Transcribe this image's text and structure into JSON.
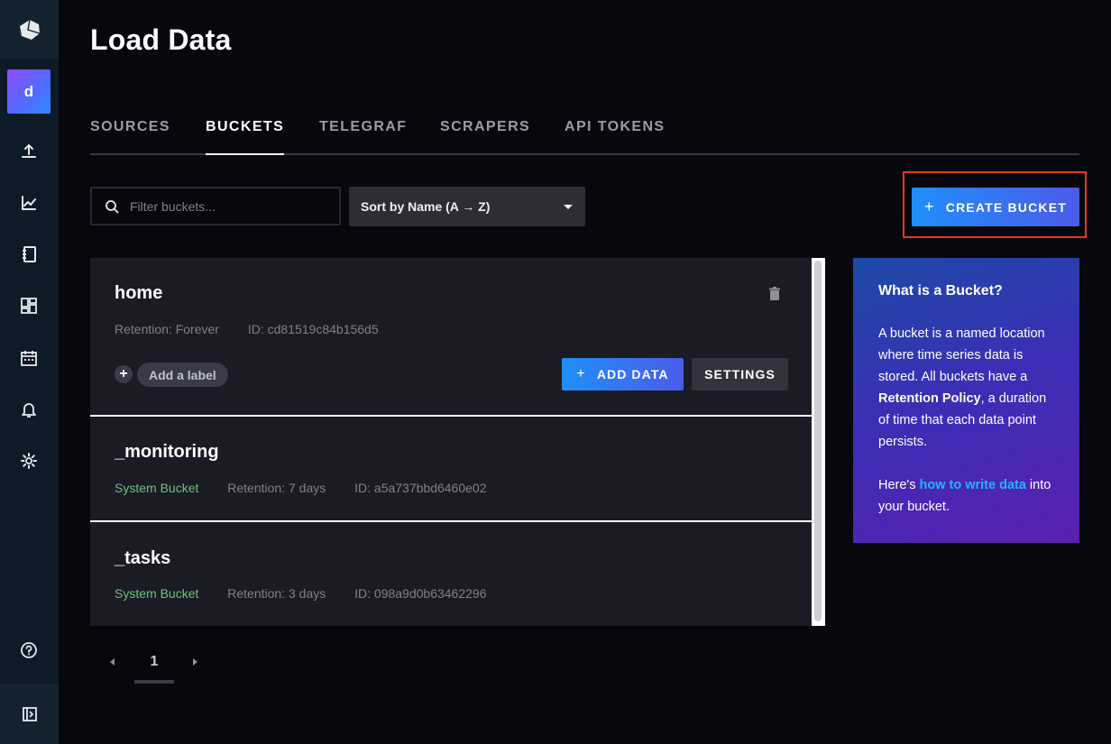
{
  "sidebar": {
    "avatar_letter": "d",
    "icons": [
      "influx-logo-icon",
      "upload-icon",
      "graph-icon",
      "notebook-icon",
      "dashboard-icon",
      "calendar-icon",
      "bell-icon",
      "gear-icon",
      "help-icon",
      "collapse-icon"
    ]
  },
  "header": {
    "title": "Load Data"
  },
  "tabs": [
    {
      "label": "SOURCES",
      "active": false
    },
    {
      "label": "BUCKETS",
      "active": true
    },
    {
      "label": "TELEGRAF",
      "active": false
    },
    {
      "label": "SCRAPERS",
      "active": false
    },
    {
      "label": "API TOKENS",
      "active": false
    }
  ],
  "filter": {
    "placeholder": "Filter buckets...",
    "value": ""
  },
  "sort": {
    "label": "Sort by Name (A → Z)"
  },
  "create_button": {
    "plus": "+",
    "label": "CREATE BUCKET"
  },
  "buckets": [
    {
      "name": "home",
      "retention": "Retention: Forever",
      "id": "ID: cd81519c84b156d5",
      "add_label": "Add a label",
      "add_label_plus": "+",
      "add_data": "ADD DATA",
      "add_data_plus": "+",
      "settings": "SETTINGS"
    },
    {
      "name": "_monitoring",
      "system": "System Bucket",
      "retention": "Retention: 7 days",
      "id": "ID: a5a737bbd6460e02"
    },
    {
      "name": "_tasks",
      "system": "System Bucket",
      "retention": "Retention: 3 days",
      "id": "ID: 098a9d0b63462296"
    }
  ],
  "info": {
    "title": "What is a Bucket?",
    "p1_start": "A bucket is a named location where time series data is stored. All buckets have a ",
    "p1_bold": "Retention Policy",
    "p1_end": ", a duration of time that each data point persists.",
    "p2_start": "Here's ",
    "p2_link": "how to write data",
    "p2_end": " into your bucket."
  },
  "pagination": {
    "current": "1"
  },
  "colors": {
    "accent_start": "#1f8ffa",
    "accent_end": "#4c5be8",
    "system_bucket": "#71c07b",
    "highlight_border": "#e8391c"
  }
}
